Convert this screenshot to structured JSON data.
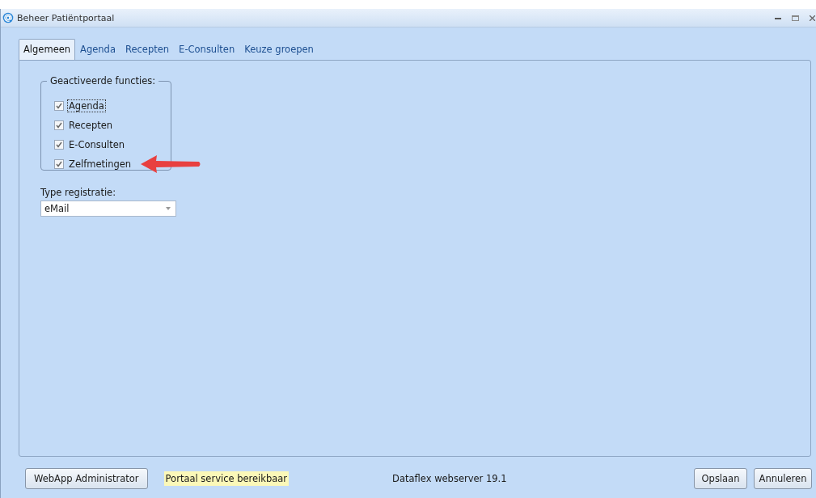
{
  "window": {
    "title": "Beheer Patiëntportaal"
  },
  "tabs": [
    {
      "label": "Algemeen",
      "selected": true
    },
    {
      "label": "Agenda",
      "selected": false
    },
    {
      "label": "Recepten",
      "selected": false
    },
    {
      "label": "E-Consulten",
      "selected": false
    },
    {
      "label": "Keuze groepen",
      "selected": false
    }
  ],
  "features": {
    "legend": "Geactiveerde functies:",
    "items": [
      {
        "label": "Agenda",
        "checked": true,
        "focused": true
      },
      {
        "label": "Recepten",
        "checked": true,
        "focused": false
      },
      {
        "label": "E-Consulten",
        "checked": true,
        "focused": false
      },
      {
        "label": "Zelfmetingen",
        "checked": true,
        "focused": false
      }
    ]
  },
  "registration": {
    "label": "Type registratie:",
    "value": "eMail"
  },
  "footer": {
    "admin_button": "WebApp Administrator",
    "status": "Portaal service bereikbaar",
    "version": "Dataflex webserver 19.1",
    "buttons": [
      "Opslaan",
      "Annuleren"
    ]
  }
}
